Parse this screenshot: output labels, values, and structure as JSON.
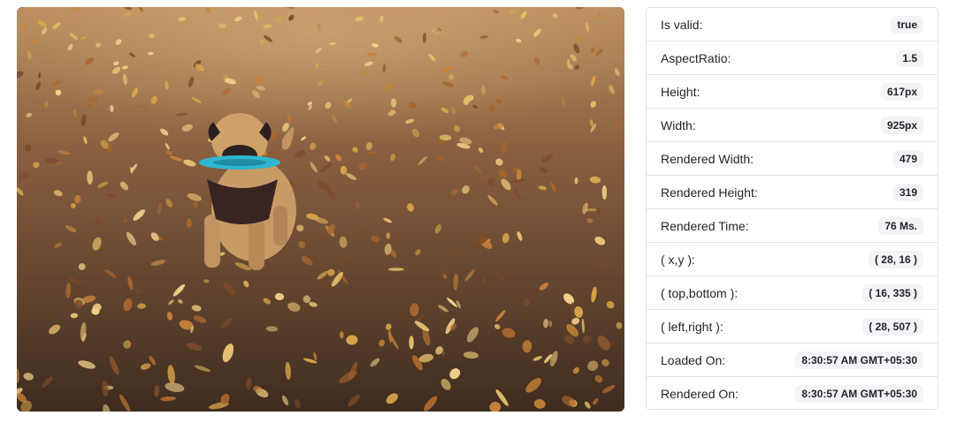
{
  "image": {
    "alt": "Pug with blue frisbee on leaf-covered ground"
  },
  "properties": [
    {
      "label": "Is valid:",
      "value": "true"
    },
    {
      "label": "AspectRatio:",
      "value": "1.5"
    },
    {
      "label": "Height:",
      "value": "617px"
    },
    {
      "label": "Width:",
      "value": "925px"
    },
    {
      "label": "Rendered Width:",
      "value": "479"
    },
    {
      "label": "Rendered Height:",
      "value": "319"
    },
    {
      "label": "Rendered Time:",
      "value": "76 Ms."
    },
    {
      "label": "( x,y ):",
      "value": "( 28, 16 )"
    },
    {
      "label": "( top,bottom ):",
      "value": "( 16, 335 )"
    },
    {
      "label": "( left,right ):",
      "value": "( 28, 507 )"
    },
    {
      "label": "Loaded On:",
      "value": "8:30:57 AM GMT+05:30"
    },
    {
      "label": "Rendered On:",
      "value": "8:30:57 AM GMT+05:30"
    }
  ]
}
